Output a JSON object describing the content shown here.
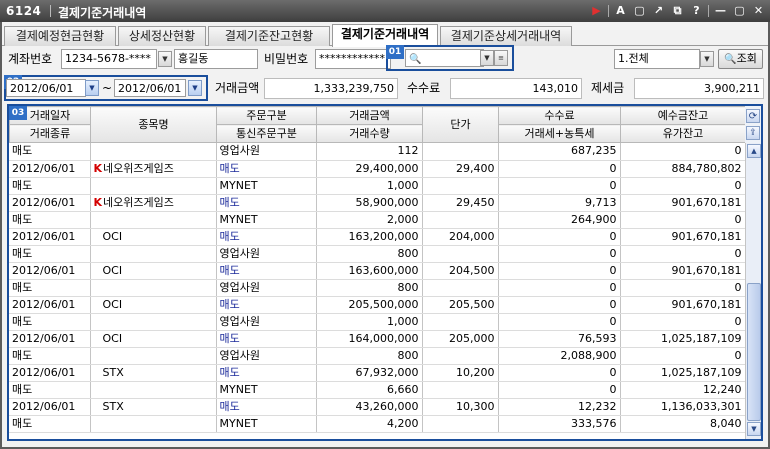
{
  "window": {
    "code": "6124",
    "title": "결제기준거래내역",
    "icons": [
      "play-icon",
      "font-icon",
      "restore-window-icon",
      "external-link-icon",
      "tile-icon",
      "help-icon",
      "minimize-icon",
      "maximize-icon",
      "close-icon"
    ],
    "icon_glyphs": [
      "▶",
      "A",
      "▢",
      "↗",
      "⧉",
      "?",
      "—",
      "▢",
      "✕"
    ]
  },
  "tabs": [
    {
      "label": "결제예정현금현황",
      "active": false
    },
    {
      "label": "상세정산현황",
      "active": false
    },
    {
      "label": "결제기준잔고현황",
      "active": false
    },
    {
      "label": "결제기준거래내역",
      "active": true
    },
    {
      "label": "결제기준상세거래내역",
      "active": false
    }
  ],
  "account": {
    "label": "계좌번호",
    "number": "1234-5678-****",
    "name": "홍길동",
    "password_label": "비밀번호",
    "password": "************"
  },
  "markers": {
    "search": "01",
    "date": "02",
    "grid": "03"
  },
  "filter": {
    "search_value": "",
    "type_value": "1.전체",
    "query_button": "조회"
  },
  "dates": {
    "from": "2012/06/01",
    "sep": "~",
    "to": "2012/06/01"
  },
  "summary": {
    "amount_label": "거래금액",
    "amount": "1,333,239,750",
    "fee_label": "수수료",
    "fee": "143,010",
    "tax_label": "제세금",
    "tax": "3,900,211"
  },
  "grid": {
    "headers_top": [
      "거래일자",
      "종목명",
      "주문구분",
      "거래금액",
      "단가",
      "수수료",
      "예수금잔고"
    ],
    "headers_bottom": [
      "거래종류",
      "통신주문구분",
      "거래수량",
      "거래세+농특세",
      "유가잔고"
    ],
    "rows": [
      {
        "date": "매도",
        "k": false,
        "name": "",
        "order": "영업사원",
        "amount": "112",
        "price": "",
        "fee": "687,235",
        "balance": "0",
        "buy": false
      },
      {
        "date": "2012/06/01",
        "k": true,
        "name": "네오위즈게임즈",
        "order": "매도",
        "amount": "29,400,000",
        "price": "29,400",
        "fee": "0",
        "balance": "884,780,802",
        "buy": true
      },
      {
        "date": "매도",
        "k": false,
        "name": "",
        "order": "MYNET",
        "amount": "1,000",
        "price": "",
        "fee": "0",
        "balance": "0",
        "buy": false
      },
      {
        "date": "2012/06/01",
        "k": true,
        "name": "네오위즈게임즈",
        "order": "매도",
        "amount": "58,900,000",
        "price": "29,450",
        "fee": "9,713",
        "balance": "901,670,181",
        "buy": true
      },
      {
        "date": "매도",
        "k": false,
        "name": "",
        "order": "MYNET",
        "amount": "2,000",
        "price": "",
        "fee": "264,900",
        "balance": "0",
        "buy": false
      },
      {
        "date": "2012/06/01",
        "k": false,
        "name": "OCI",
        "order": "매도",
        "amount": "163,200,000",
        "price": "204,000",
        "fee": "0",
        "balance": "901,670,181",
        "buy": true
      },
      {
        "date": "매도",
        "k": false,
        "name": "",
        "order": "영업사원",
        "amount": "800",
        "price": "",
        "fee": "0",
        "balance": "0",
        "buy": false
      },
      {
        "date": "2012/06/01",
        "k": false,
        "name": "OCI",
        "order": "매도",
        "amount": "163,600,000",
        "price": "204,500",
        "fee": "0",
        "balance": "901,670,181",
        "buy": true
      },
      {
        "date": "매도",
        "k": false,
        "name": "",
        "order": "영업사원",
        "amount": "800",
        "price": "",
        "fee": "0",
        "balance": "0",
        "buy": false
      },
      {
        "date": "2012/06/01",
        "k": false,
        "name": "OCI",
        "order": "매도",
        "amount": "205,500,000",
        "price": "205,500",
        "fee": "0",
        "balance": "901,670,181",
        "buy": true
      },
      {
        "date": "매도",
        "k": false,
        "name": "",
        "order": "영업사원",
        "amount": "1,000",
        "price": "",
        "fee": "0",
        "balance": "0",
        "buy": false
      },
      {
        "date": "2012/06/01",
        "k": false,
        "name": "OCI",
        "order": "매도",
        "amount": "164,000,000",
        "price": "205,000",
        "fee": "76,593",
        "balance": "1,025,187,109",
        "buy": true
      },
      {
        "date": "매도",
        "k": false,
        "name": "",
        "order": "영업사원",
        "amount": "800",
        "price": "",
        "fee": "2,088,900",
        "balance": "0",
        "buy": false
      },
      {
        "date": "2012/06/01",
        "k": false,
        "name": "STX",
        "order": "매도",
        "amount": "67,932,000",
        "price": "10,200",
        "fee": "0",
        "balance": "1,025,187,109",
        "buy": true
      },
      {
        "date": "매도",
        "k": false,
        "name": "",
        "order": "MYNET",
        "amount": "6,660",
        "price": "",
        "fee": "0",
        "balance": "12,240",
        "buy": false
      },
      {
        "date": "2012/06/01",
        "k": false,
        "name": "STX",
        "order": "매도",
        "amount": "43,260,000",
        "price": "10,300",
        "fee": "12,232",
        "balance": "1,136,033,301",
        "buy": true
      },
      {
        "date": "매도",
        "k": false,
        "name": "",
        "order": "MYNET",
        "amount": "4,200",
        "price": "",
        "fee": "333,576",
        "balance": "8,040",
        "buy": false
      }
    ]
  }
}
